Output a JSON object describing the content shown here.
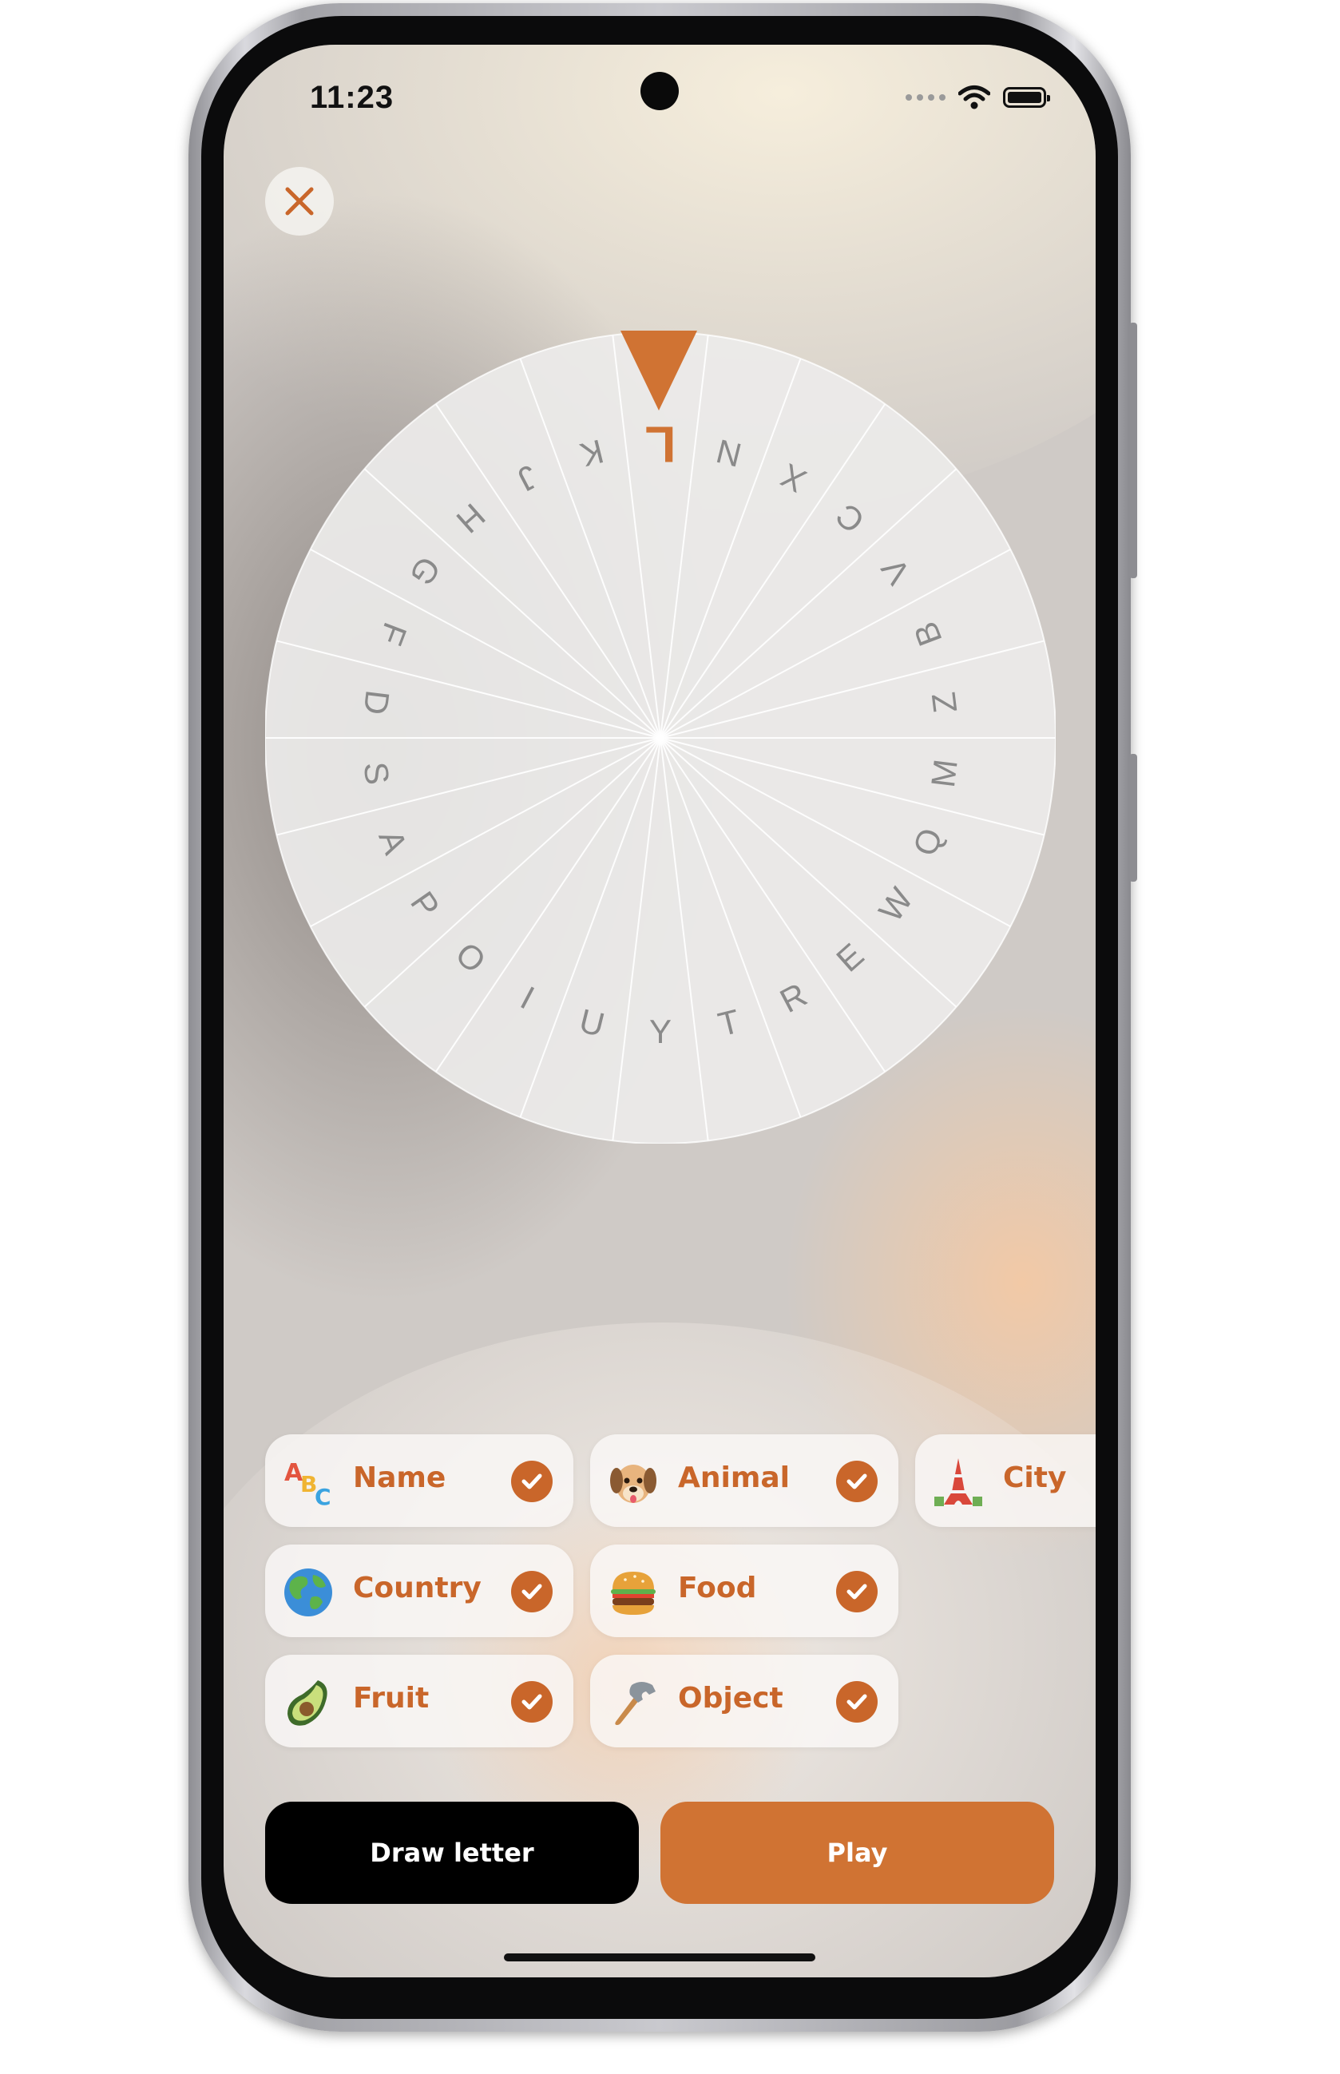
{
  "status_bar": {
    "time": "11:23"
  },
  "wheel": {
    "letters": [
      "L",
      "N",
      "X",
      "C",
      "V",
      "B",
      "Z",
      "M",
      "Q",
      "W",
      "E",
      "R",
      "T",
      "Y",
      "U",
      "I",
      "O",
      "P",
      "A",
      "S",
      "D",
      "F",
      "G",
      "H",
      "J",
      "K"
    ],
    "selected_letter": "L",
    "accent_color": "#d07333"
  },
  "categories": [
    {
      "label": "Name",
      "icon": "abc-icon",
      "checked": true
    },
    {
      "label": "Animal",
      "icon": "dog-icon",
      "checked": true
    },
    {
      "label": "City",
      "icon": "tower-icon",
      "checked": false
    },
    {
      "label": "Country",
      "icon": "globe-icon",
      "checked": true
    },
    {
      "label": "Food",
      "icon": "burger-icon",
      "checked": true
    },
    {
      "label": "Fruit",
      "icon": "avocado-icon",
      "checked": true
    },
    {
      "label": "Object",
      "icon": "hammer-icon",
      "checked": true
    }
  ],
  "buttons": {
    "draw_letter": "Draw letter",
    "play": "Play"
  },
  "colors": {
    "accent": "#c9662a",
    "play_button": "#d07333",
    "draw_button": "#000000"
  }
}
